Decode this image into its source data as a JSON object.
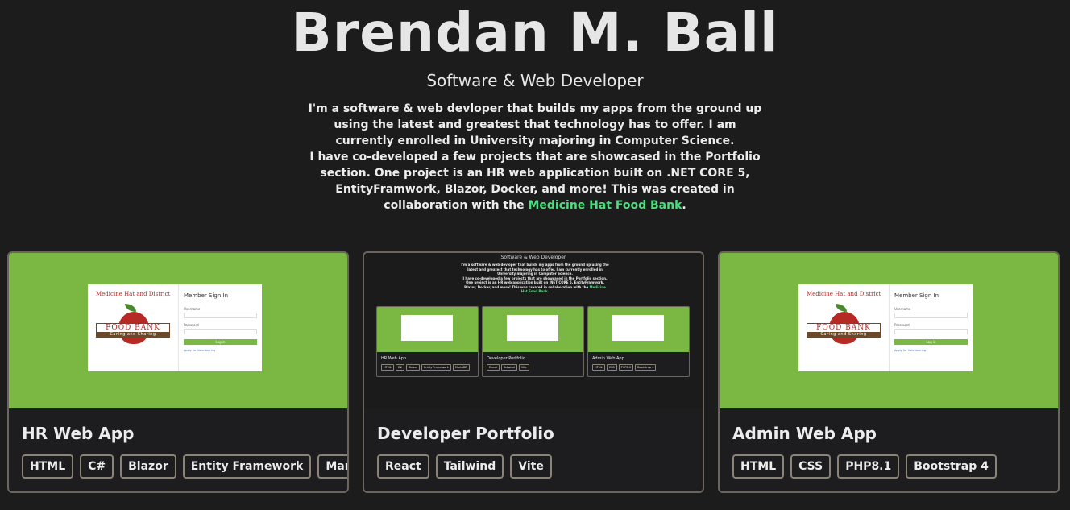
{
  "hero": {
    "name": "Brendan M. Ball",
    "subtitle": "Software & Web Developer",
    "bio_part1": "I'm a software & web devloper that builds my apps from the ground up using the latest and greatest that technology has to offer. I am currently enrolled in University majoring in Computer Science.",
    "bio_part2": "I have co-developed a few projects that are showcased in the Portfolio section. One project is an HR web application built on .NET CORE 5, EntityFramwork, Blazor, Docker, and more! This was created in collaboration with the ",
    "bio_link": "Medicine Hat Food Bank",
    "bio_end": "."
  },
  "colors": {
    "background": "#1c1c1c",
    "accent_green": "#4ade80",
    "thumb_green": "#7ab843",
    "card_border": "#6b655d"
  },
  "thumbnail": {
    "login_title": "Member Sign In",
    "username_label": "Username",
    "password_label": "Password",
    "login_button": "Log in",
    "volunteer_link": "Apply for Volunteering",
    "logo_arc": "Medicine Hat and District",
    "logo_main": "FOOD BANK",
    "logo_band": "Caring and Sharing"
  },
  "projects": [
    {
      "title": "HR Web App",
      "tags": [
        "HTML",
        "C#",
        "Blazor",
        "Entity Framework",
        "MariaDB"
      ]
    },
    {
      "title": "Developer Portfolio",
      "tags": [
        "React",
        "Tailwind",
        "Vite"
      ]
    },
    {
      "title": "Admin Web App",
      "tags": [
        "HTML",
        "CSS",
        "PHP8.1",
        "Bootstrap 4"
      ]
    }
  ]
}
